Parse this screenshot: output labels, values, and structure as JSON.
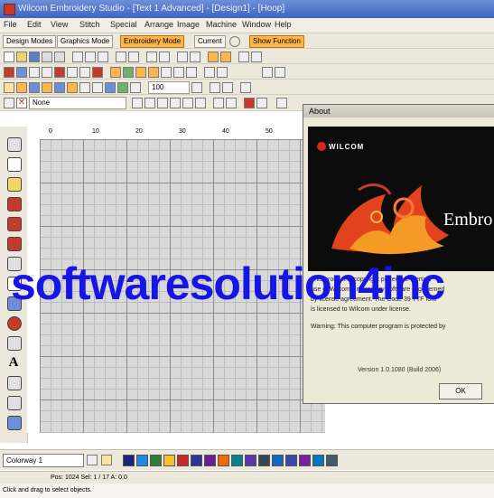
{
  "window": {
    "title": "Wilcom Embroidery Studio - [Text 1 Advanced] - [Design1] - [Hoop]"
  },
  "menu": [
    "File",
    "Edit",
    "View",
    "Stitch",
    "Special",
    "Arrange",
    "Image",
    "Machine",
    "Window",
    "Help"
  ],
  "toolbar": {
    "design_modes_label": "Design Modes",
    "graphics_mode_label": "Graphics Mode",
    "embroidery_mode_label": "Embroidery Mode",
    "current_label": "Current",
    "show_function_label": "Show Function",
    "fill_style_value": "None",
    "zoom_value": "100"
  },
  "ruler": {
    "ticks": [
      "0",
      "10",
      "20",
      "30",
      "40",
      "50"
    ]
  },
  "about_dialog": {
    "title": "About",
    "logo_text": "WILCOM",
    "product_name_partial": "Embro",
    "body_lines": [
      "This product is copyright protected. Certain",
      "use of Wilcom Embroidery software is governed",
      "by license agreement. The Code 39 TTF font",
      "is licensed to Wilcom under license.",
      "Warning: This computer program is protected by"
    ],
    "version": "Version 1.0.1080 (Build 2006)",
    "ok_label": "OK"
  },
  "watermark_text": "softwaresolution4inc",
  "colorway": {
    "selected": "Colorway 1",
    "swatches": [
      "#1a237e",
      "#1e88e5",
      "#2e7d32",
      "#fbc02d",
      "#c62828",
      "#283593",
      "#6a1b9a",
      "#ef6c00",
      "#00838f",
      "#5e35b1",
      "#37474f",
      "#1565c0",
      "#3949ab",
      "#7b1fa2",
      "#0277bd",
      "#455a64"
    ]
  },
  "status": {
    "position": "Pos: 1024  Sel: 1 / 17  A: 0.0",
    "hint": "Click and drag to select objects."
  }
}
